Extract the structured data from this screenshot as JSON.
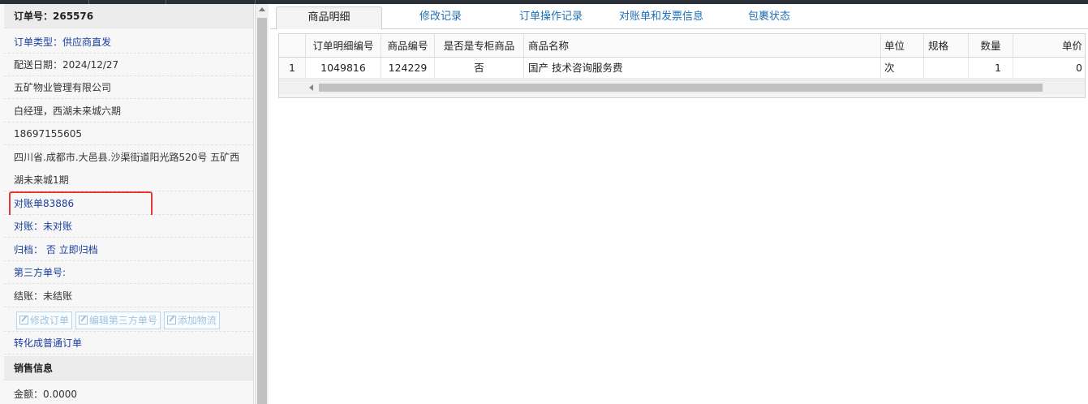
{
  "order": {
    "number_label": "订单号：265576",
    "type_label": "订单类型：供应商直发",
    "delivery_date": "配送日期：2024/12/27",
    "company": "五矿物业管理有限公司",
    "contact": "白经理，西湖未来城六期",
    "phone": "18697155605",
    "address": "四川省.成都市.大邑县.沙渠街道阳光路520号 五矿西湖未来城1期",
    "bill_link": "对账单83886",
    "reconcile": "对账：未对账",
    "archive": "归档： 否 立即归档",
    "third_party": "第三方单号:",
    "settlement": "结账：未结账",
    "buttons": {
      "edit_order": "修改订单",
      "edit_third_party": "编辑第三方单号",
      "add_logistics": "添加物流"
    },
    "convert_link": "转化成普通订单",
    "sales_header": "销售信息",
    "amount": "金额：0.0000"
  },
  "tabs": [
    {
      "label": "商品明细",
      "active": true
    },
    {
      "label": "修改记录",
      "active": false
    },
    {
      "label": "订单操作记录",
      "active": false
    },
    {
      "label": "对账单和发票信息",
      "active": false
    },
    {
      "label": "包裹状态",
      "active": false
    }
  ],
  "grid": {
    "columns": [
      "订单明细编号",
      "商品编号",
      "是否是专柜商品",
      "商品名称",
      "单位",
      "规格",
      "数量",
      "单价"
    ],
    "rows": [
      {
        "row_num": "1",
        "detail_id": "1049816",
        "product_id": "124229",
        "is_counter": "否",
        "name": "国产 技术咨询服务费",
        "unit": "次",
        "spec": "",
        "qty": "1",
        "price": "0"
      }
    ]
  },
  "colors": {
    "link": "#1a3fa0",
    "tab_link": "#1f6fb5",
    "highlight": "#e53935",
    "disabled": "#9fc3df"
  }
}
